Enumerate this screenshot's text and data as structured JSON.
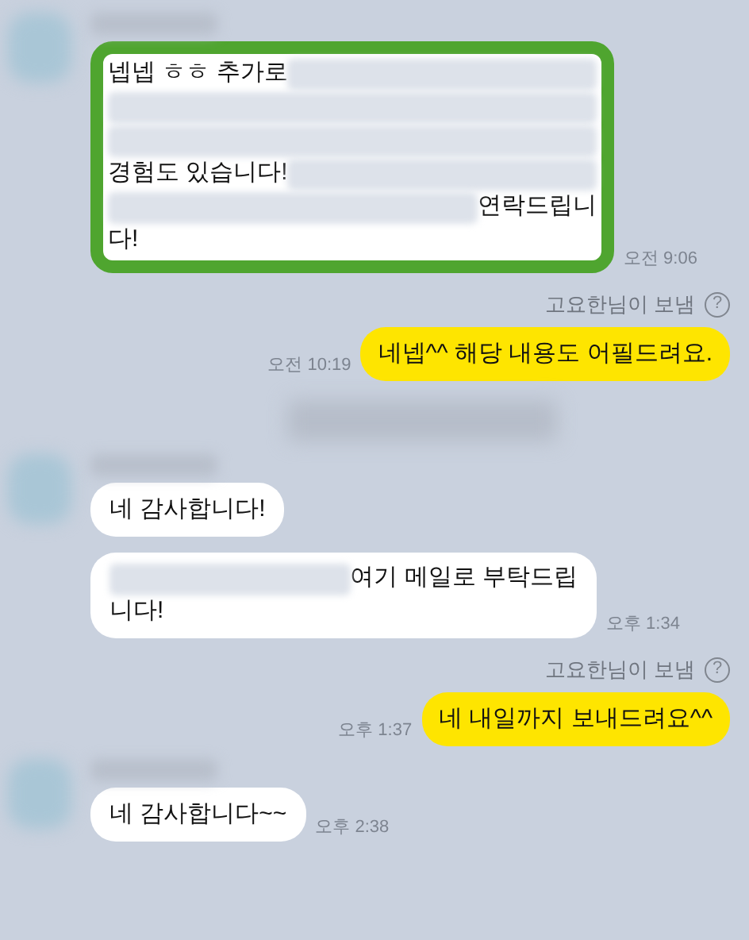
{
  "messages": [
    {
      "kind": "received",
      "show_profile": true,
      "highlighted": true,
      "lines": [
        [
          {
            "kind": "text",
            "text": "넵넵 ㅎㅎ 추가로"
          },
          {
            "kind": "redacted"
          }
        ],
        [
          {
            "kind": "redacted"
          }
        ],
        [
          {
            "kind": "redacted"
          }
        ],
        [
          {
            "kind": "text",
            "text": "경험도 있습니다!"
          },
          {
            "kind": "redacted"
          }
        ],
        [
          {
            "kind": "redacted"
          },
          {
            "kind": "text",
            "text": "연락드립니"
          }
        ],
        [
          {
            "kind": "text",
            "text": "다!"
          }
        ]
      ],
      "time": "오전 9:06"
    },
    {
      "kind": "sent",
      "sender_note": "고요한님이 보냄",
      "help": "?",
      "text": "네넵^^ 해당 내용도 어필드려요.",
      "time": "오전 10:19"
    },
    {
      "kind": "redacted_notice"
    },
    {
      "kind": "received",
      "show_profile": true,
      "highlighted": false,
      "text": "네 감사합니다!"
    },
    {
      "kind": "received",
      "show_profile": false,
      "highlighted": false,
      "lines": [
        [
          {
            "kind": "redacted"
          },
          {
            "kind": "text",
            "text": "여기 메일로 부탁드립"
          }
        ],
        [
          {
            "kind": "text",
            "text": "니다!"
          }
        ]
      ],
      "time": "오후 1:34"
    },
    {
      "kind": "sent",
      "sender_note": "고요한님이 보냄",
      "help": "?",
      "text": "네 내일까지 보내드려요^^",
      "time": "오후 1:37"
    },
    {
      "kind": "received",
      "show_profile": true,
      "highlighted": false,
      "text": "네 감사합니다~~",
      "time": "오후 2:38"
    }
  ]
}
